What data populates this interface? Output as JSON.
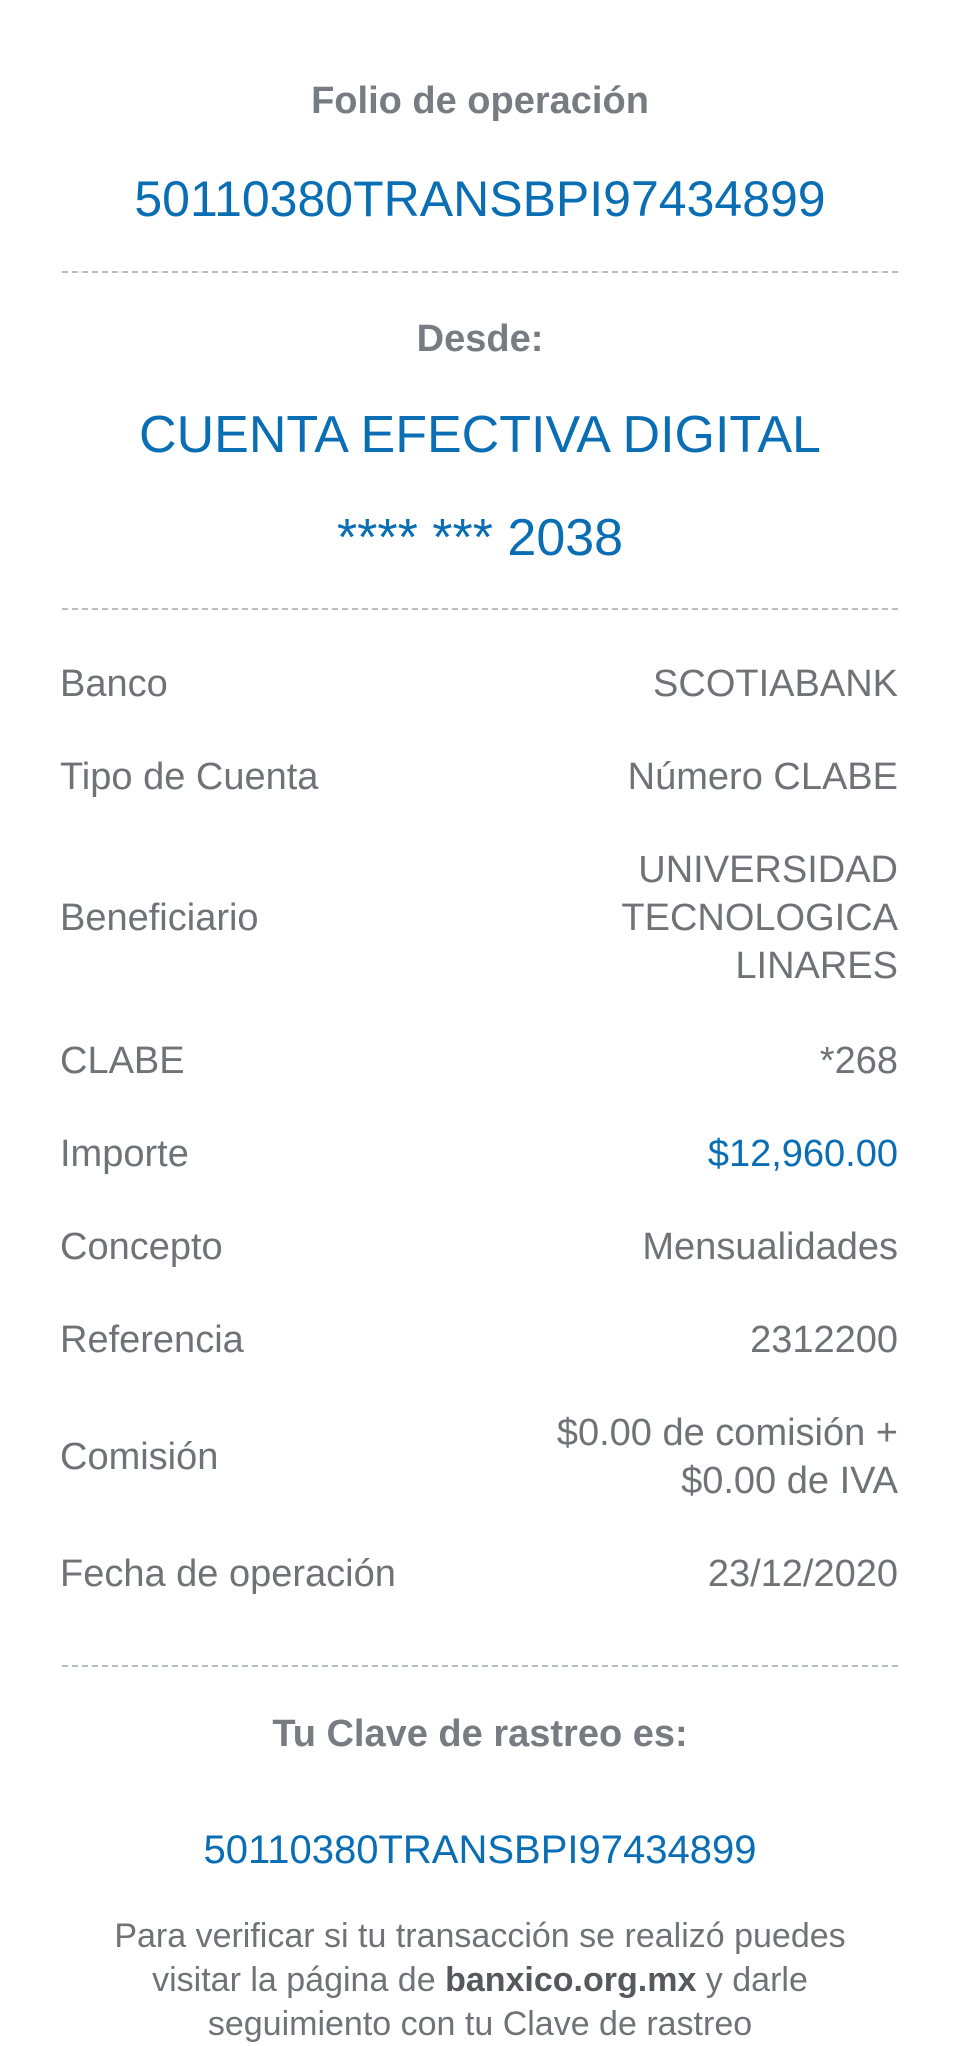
{
  "header": {
    "folio_label": "Folio de operación",
    "folio_value": "50110380TRANSBPI97434899"
  },
  "source": {
    "label": "Desde:",
    "account_name": "CUENTA EFECTIVA DIGITAL",
    "account_number": "**** *** 2038"
  },
  "details": {
    "banco": {
      "label": "Banco",
      "value": "SCOTIABANK"
    },
    "tipo_cuenta": {
      "label": "Tipo de Cuenta",
      "value": "Número CLABE"
    },
    "beneficiario": {
      "label": "Beneficiario",
      "value_lines": [
        "UNIVERSIDAD",
        "TECNOLOGICA",
        "LINARES"
      ]
    },
    "clabe": {
      "label": "CLABE",
      "value": "*268"
    },
    "importe": {
      "label": "Importe",
      "value": "$12,960.00"
    },
    "concepto": {
      "label": "Concepto",
      "value": "Mensualidades"
    },
    "referencia": {
      "label": "Referencia",
      "value": "2312200"
    },
    "comision": {
      "label": "Comisión",
      "value_lines": [
        "$0.00 de comisión +",
        "$0.00 de IVA"
      ]
    },
    "fecha": {
      "label": "Fecha de operación",
      "value": "23/12/2020"
    }
  },
  "tracking": {
    "label": "Tu Clave de rastreo es:",
    "value": "50110380TRANSBPI97434899"
  },
  "footer": {
    "line1": "Para verificar si tu transacción se realizó puedes",
    "line2_pre": "visitar la página de ",
    "line2_link": "banxico.org.mx",
    "line2_post": " y darle",
    "line3": "seguimiento con tu Clave de rastreo"
  },
  "colors": {
    "accent": "#0a6eb4",
    "text": "#6f7378",
    "divider": "#b9bcc0"
  }
}
